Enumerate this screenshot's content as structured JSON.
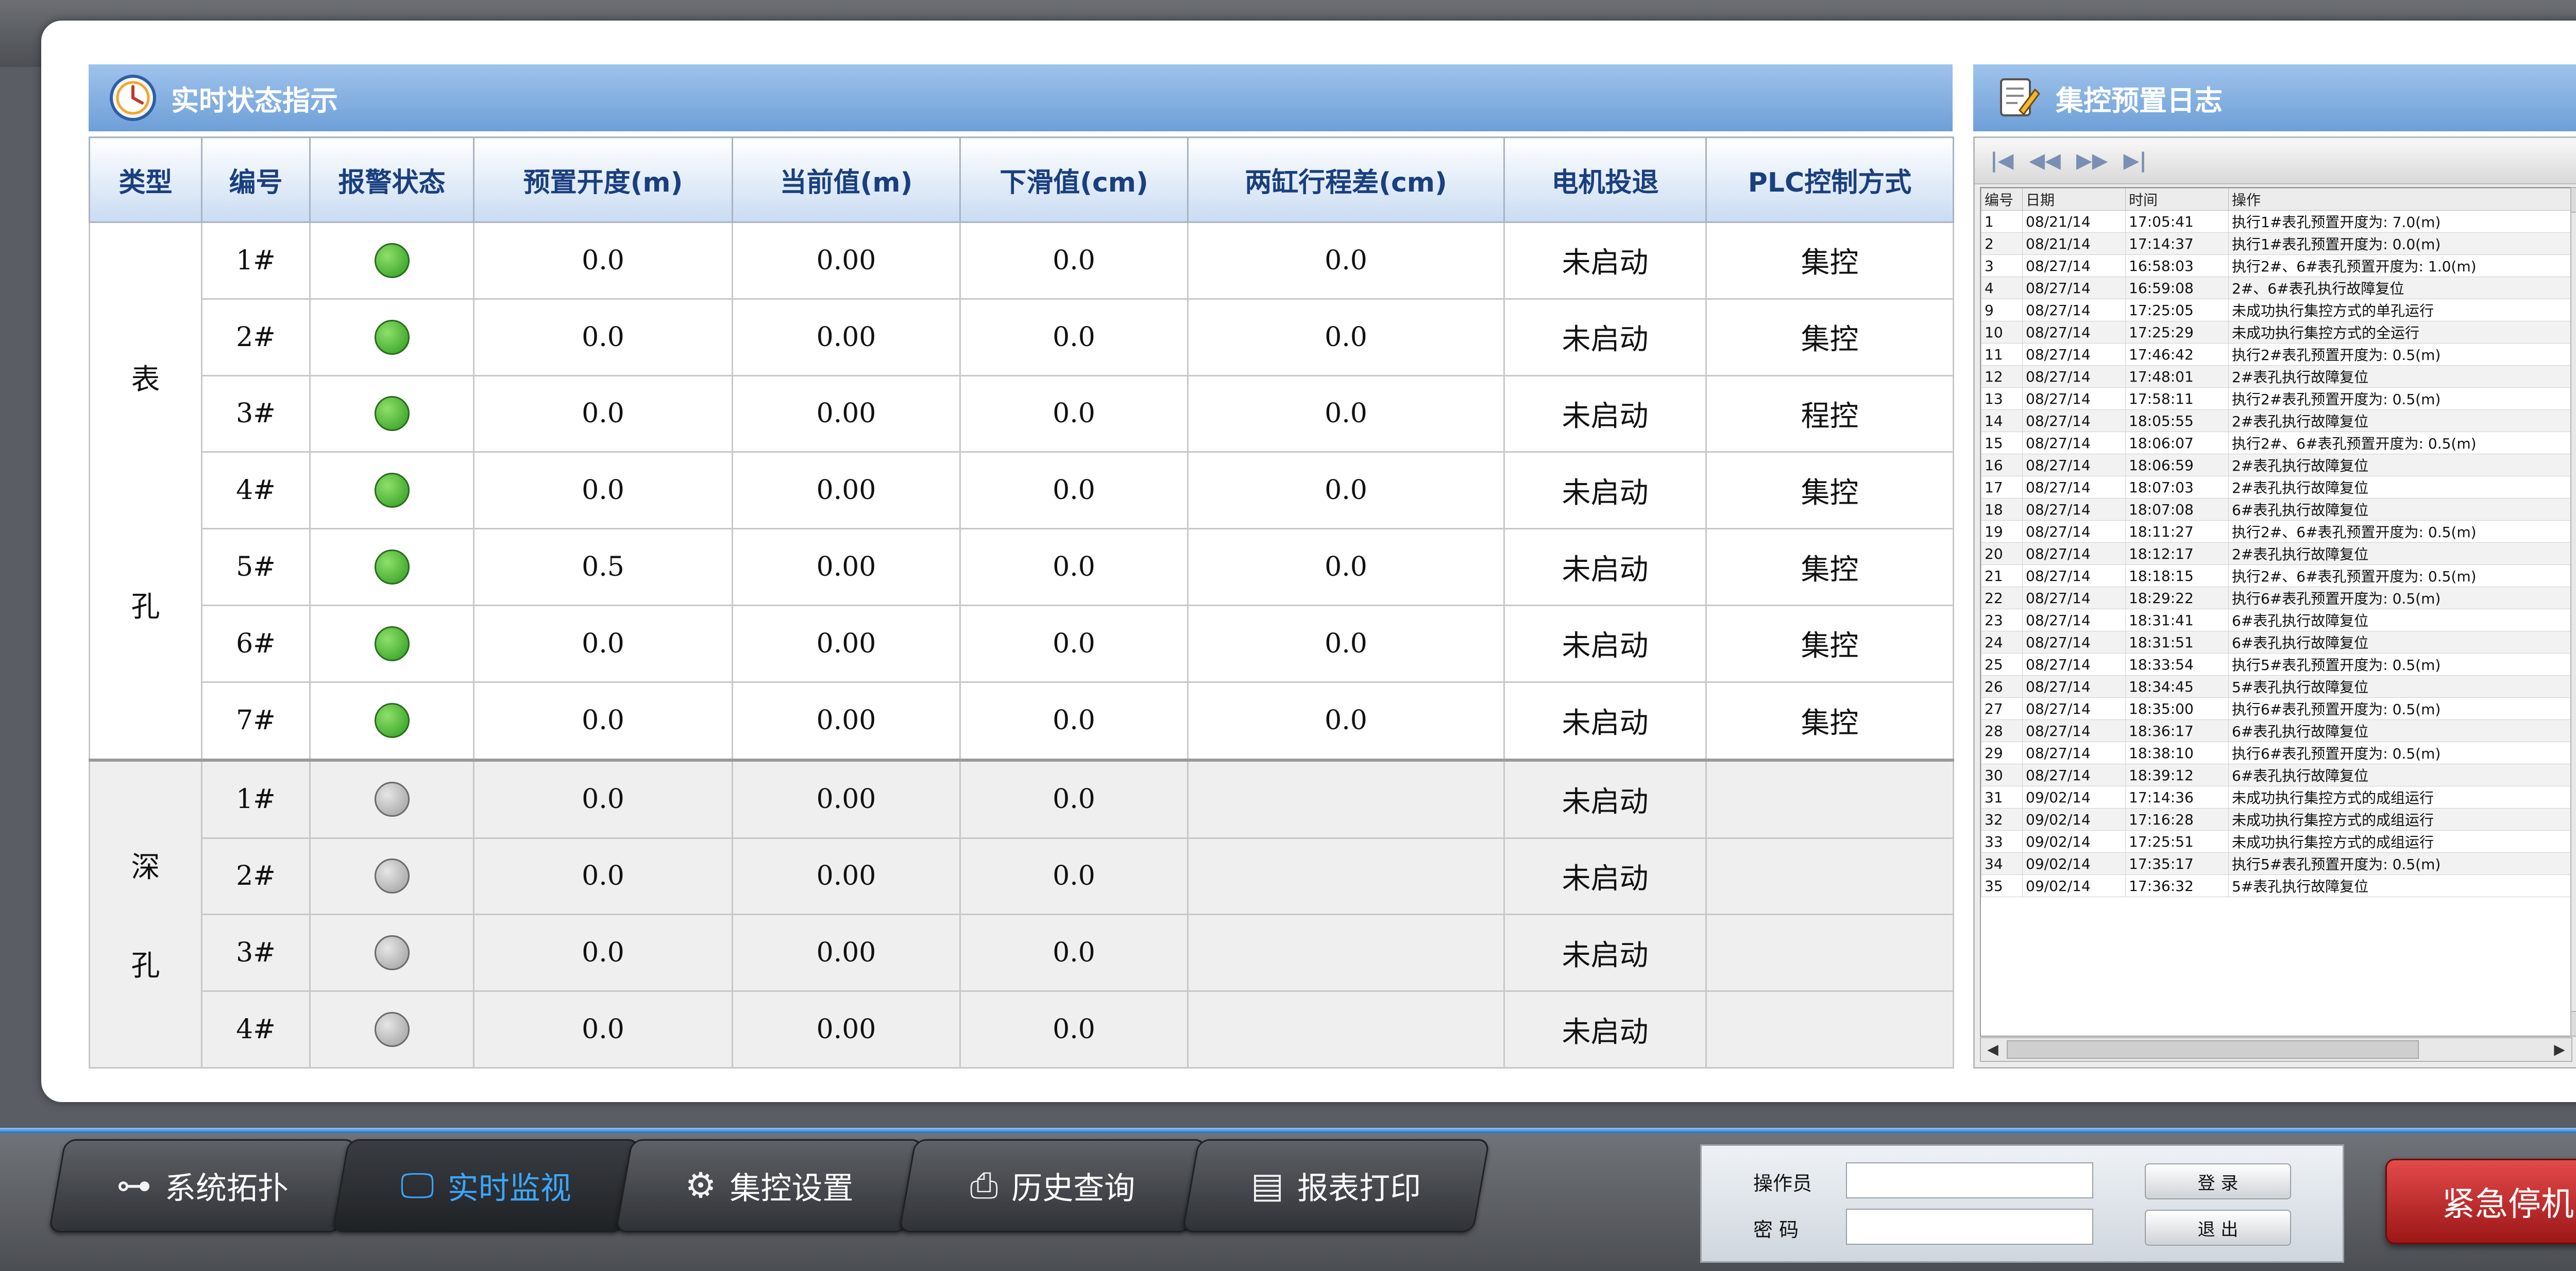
{
  "colors": {
    "header_blue": "#6e9fd8",
    "status_green": "#2d9a1e",
    "status_gray": "#9c9c9c",
    "estop_red": "#c42a2a",
    "active_tab": "#3aa7ff"
  },
  "status_panel": {
    "title": "实时状态指示",
    "icon": "clock-icon",
    "columns": [
      "类型",
      "编号",
      "报警状态",
      "预置开度(m)",
      "当前值(m)",
      "下滑值(cm)",
      "两缸行程差(cm)",
      "电机投退",
      "PLC控制方式"
    ],
    "surface": {
      "type_chars": [
        "表",
        "孔"
      ],
      "rows": [
        {
          "id": "1#",
          "status": "green",
          "preset": "0.0",
          "current": "0.00",
          "slide": "0.0",
          "diff": "0.0",
          "motor": "未启动",
          "mode": "集控"
        },
        {
          "id": "2#",
          "status": "green",
          "preset": "0.0",
          "current": "0.00",
          "slide": "0.0",
          "diff": "0.0",
          "motor": "未启动",
          "mode": "集控"
        },
        {
          "id": "3#",
          "status": "green",
          "preset": "0.0",
          "current": "0.00",
          "slide": "0.0",
          "diff": "0.0",
          "motor": "未启动",
          "mode": "程控"
        },
        {
          "id": "4#",
          "status": "green",
          "preset": "0.0",
          "current": "0.00",
          "slide": "0.0",
          "diff": "0.0",
          "motor": "未启动",
          "mode": "集控"
        },
        {
          "id": "5#",
          "status": "green",
          "preset": "0.5",
          "current": "0.00",
          "slide": "0.0",
          "diff": "0.0",
          "motor": "未启动",
          "mode": "集控"
        },
        {
          "id": "6#",
          "status": "green",
          "preset": "0.0",
          "current": "0.00",
          "slide": "0.0",
          "diff": "0.0",
          "motor": "未启动",
          "mode": "集控"
        },
        {
          "id": "7#",
          "status": "green",
          "preset": "0.0",
          "current": "0.00",
          "slide": "0.0",
          "diff": "0.0",
          "motor": "未启动",
          "mode": "集控"
        }
      ]
    },
    "deep": {
      "type_chars": [
        "深",
        "孔"
      ],
      "rows": [
        {
          "id": "1#",
          "status": "gray",
          "preset": "0.0",
          "current": "0.00",
          "slide": "0.0",
          "diff": "",
          "motor": "未启动",
          "mode": ""
        },
        {
          "id": "2#",
          "status": "gray",
          "preset": "0.0",
          "current": "0.00",
          "slide": "0.0",
          "diff": "",
          "motor": "未启动",
          "mode": ""
        },
        {
          "id": "3#",
          "status": "gray",
          "preset": "0.0",
          "current": "0.00",
          "slide": "0.0",
          "diff": "",
          "motor": "未启动",
          "mode": ""
        },
        {
          "id": "4#",
          "status": "gray",
          "preset": "0.0",
          "current": "0.00",
          "slide": "0.0",
          "diff": "",
          "motor": "未启动",
          "mode": ""
        }
      ]
    }
  },
  "log_panel": {
    "title": "集控预置日志",
    "icon": "edit-log-icon",
    "nav": [
      "|◀",
      "◀◀",
      "▶▶",
      "▶|"
    ],
    "columns": [
      "编号",
      "日期",
      "时间",
      "操作"
    ],
    "rows": [
      [
        "1",
        "08/21/14",
        "17:05:41",
        "执行1#表孔预置开度为: 7.0(m)"
      ],
      [
        "2",
        "08/21/14",
        "17:14:37",
        "执行1#表孔预置开度为: 0.0(m)"
      ],
      [
        "3",
        "08/27/14",
        "16:58:03",
        "执行2#、6#表孔预置开度为: 1.0(m)"
      ],
      [
        "4",
        "08/27/14",
        "16:59:08",
        "2#、6#表孔执行故障复位"
      ],
      [
        "9",
        "08/27/14",
        "17:25:05",
        "未成功执行集控方式的单孔运行"
      ],
      [
        "10",
        "08/27/14",
        "17:25:29",
        "未成功执行集控方式的全运行"
      ],
      [
        "11",
        "08/27/14",
        "17:46:42",
        "执行2#表孔预置开度为: 0.5(m)"
      ],
      [
        "12",
        "08/27/14",
        "17:48:01",
        "2#表孔执行故障复位"
      ],
      [
        "13",
        "08/27/14",
        "17:58:11",
        "执行2#表孔预置开度为: 0.5(m)"
      ],
      [
        "14",
        "08/27/14",
        "18:05:55",
        "2#表孔执行故障复位"
      ],
      [
        "15",
        "08/27/14",
        "18:06:07",
        "执行2#、6#表孔预置开度为: 0.5(m)"
      ],
      [
        "16",
        "08/27/14",
        "18:06:59",
        "2#表孔执行故障复位"
      ],
      [
        "17",
        "08/27/14",
        "18:07:03",
        "2#表孔执行故障复位"
      ],
      [
        "18",
        "08/27/14",
        "18:07:08",
        "6#表孔执行故障复位"
      ],
      [
        "19",
        "08/27/14",
        "18:11:27",
        "执行2#、6#表孔预置开度为: 0.5(m)"
      ],
      [
        "20",
        "08/27/14",
        "18:12:17",
        "2#表孔执行故障复位"
      ],
      [
        "21",
        "08/27/14",
        "18:18:15",
        "执行2#、6#表孔预置开度为: 0.5(m)"
      ],
      [
        "22",
        "08/27/14",
        "18:29:22",
        "执行6#表孔预置开度为: 0.5(m)"
      ],
      [
        "23",
        "08/27/14",
        "18:31:41",
        "6#表孔执行故障复位"
      ],
      [
        "24",
        "08/27/14",
        "18:31:51",
        "6#表孔执行故障复位"
      ],
      [
        "25",
        "08/27/14",
        "18:33:54",
        "执行5#表孔预置开度为: 0.5(m)"
      ],
      [
        "26",
        "08/27/14",
        "18:34:45",
        "5#表孔执行故障复位"
      ],
      [
        "27",
        "08/27/14",
        "18:35:00",
        "执行6#表孔预置开度为: 0.5(m)"
      ],
      [
        "28",
        "08/27/14",
        "18:36:17",
        "6#表孔执行故障复位"
      ],
      [
        "29",
        "08/27/14",
        "18:38:10",
        "执行6#表孔预置开度为: 0.5(m)"
      ],
      [
        "30",
        "08/27/14",
        "18:39:12",
        "6#表孔执行故障复位"
      ],
      [
        "31",
        "09/02/14",
        "17:14:36",
        "未成功执行集控方式的成组运行"
      ],
      [
        "32",
        "09/02/14",
        "17:16:28",
        "未成功执行集控方式的成组运行"
      ],
      [
        "33",
        "09/02/14",
        "17:25:51",
        "未成功执行集控方式的成组运行"
      ],
      [
        "34",
        "09/02/14",
        "17:35:17",
        "执行5#表孔预置开度为: 0.5(m)"
      ],
      [
        "35",
        "09/02/14",
        "17:36:32",
        "5#表孔执行故障复位"
      ]
    ]
  },
  "nav_tabs": [
    {
      "label": "系统拓扑",
      "icon": "topology-icon",
      "glyph": "⊶",
      "active": false
    },
    {
      "label": "实时监视",
      "icon": "monitor-icon",
      "glyph": "🖵",
      "active": true
    },
    {
      "label": "集控设置",
      "icon": "gear-icon",
      "glyph": "⚙",
      "active": false
    },
    {
      "label": "历史查询",
      "icon": "history-icon",
      "glyph": "⎙",
      "active": false
    },
    {
      "label": "报表打印",
      "icon": "report-icon",
      "glyph": "▤",
      "active": false
    }
  ],
  "login": {
    "operator_label": "操作员",
    "password_label": "密 码",
    "operator_value": "",
    "password_value": "",
    "login_button": "登 录",
    "logout_button": "退 出"
  },
  "estop_label": "紧急停机"
}
